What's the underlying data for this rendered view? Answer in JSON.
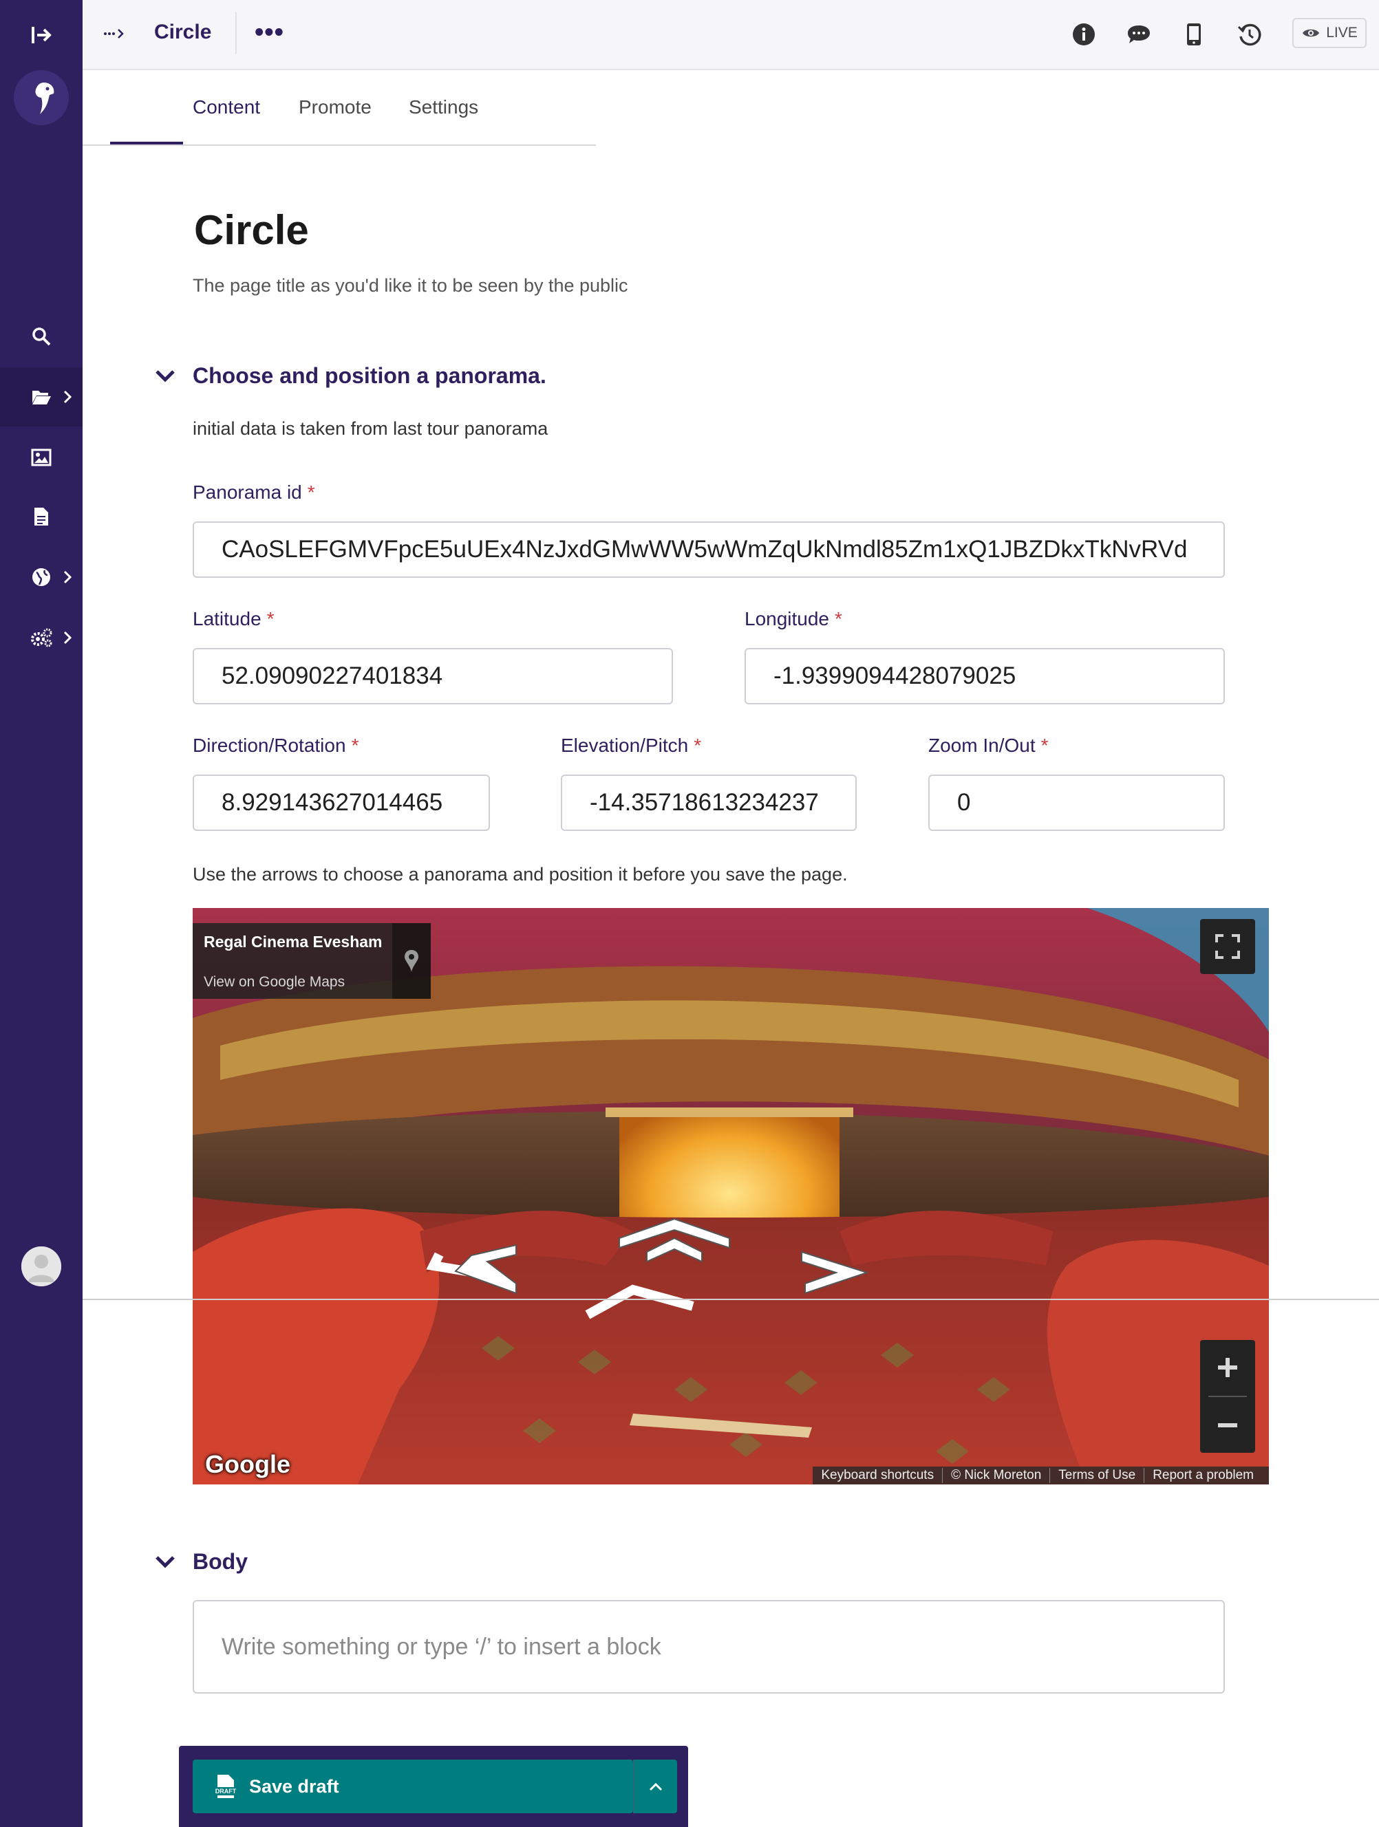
{
  "header": {
    "title": "Circle",
    "more_label": "•••",
    "live_label": "LIVE"
  },
  "tabs": [
    {
      "label": "Content"
    },
    {
      "label": "Promote"
    },
    {
      "label": "Settings"
    }
  ],
  "main": {
    "title": "Circle",
    "title_help": "The page title as you'd like it to be seen by the public",
    "panorama_section": {
      "heading": "Choose and position a panorama.",
      "help": "initial data is taken from last tour panorama",
      "panorama_id": {
        "label": "Panorama id",
        "value": "CAoSLEFGMVFpcE5uUEx4NzJxdGMwWW5wWmZqUkNmdl85Zm1xQ1JBZDkxTkNvRVd"
      },
      "latitude": {
        "label": "Latitude",
        "value": "52.09090227401834"
      },
      "longitude": {
        "label": "Longitude",
        "value": "-1.9399094428079025"
      },
      "direction": {
        "label": "Direction/Rotation",
        "value": "8.929143627014465"
      },
      "elevation": {
        "label": "Elevation/Pitch",
        "value": "-14.35718613234237"
      },
      "zoom": {
        "label": "Zoom In/Out",
        "value": "0"
      },
      "required_mark": "*",
      "instruction": "Use the arrows to choose a panorama and position it before you save the page."
    },
    "map": {
      "place_name": "Regal Cinema Evesham",
      "view_link": "View on Google Maps",
      "google_logo": "Google",
      "attribution": [
        "Keyboard shortcuts",
        "© Nick Moreton",
        "Terms of Use",
        "Report a problem"
      ]
    },
    "body_section": {
      "heading": "Body",
      "placeholder": "Write something or type ‘/’ to insert a block"
    }
  },
  "footer": {
    "save_label": "Save draft",
    "draft_badge": "DRAFT"
  },
  "colors": {
    "sidebar": "#2e1f5e",
    "accent": "#2e1f5e",
    "save_button": "#007d7e",
    "required": "#cd3c3c"
  },
  "icons": {
    "sidebar": [
      "collapse-sidebar-icon",
      "logo-icon",
      "search-icon",
      "folder-icon",
      "image-icon",
      "document-icon",
      "globe-icon",
      "cogs-icon",
      "user-avatar-icon"
    ],
    "header": [
      "info-icon",
      "comment-icon",
      "mobile-preview-icon",
      "history-icon",
      "eye-icon"
    ]
  }
}
